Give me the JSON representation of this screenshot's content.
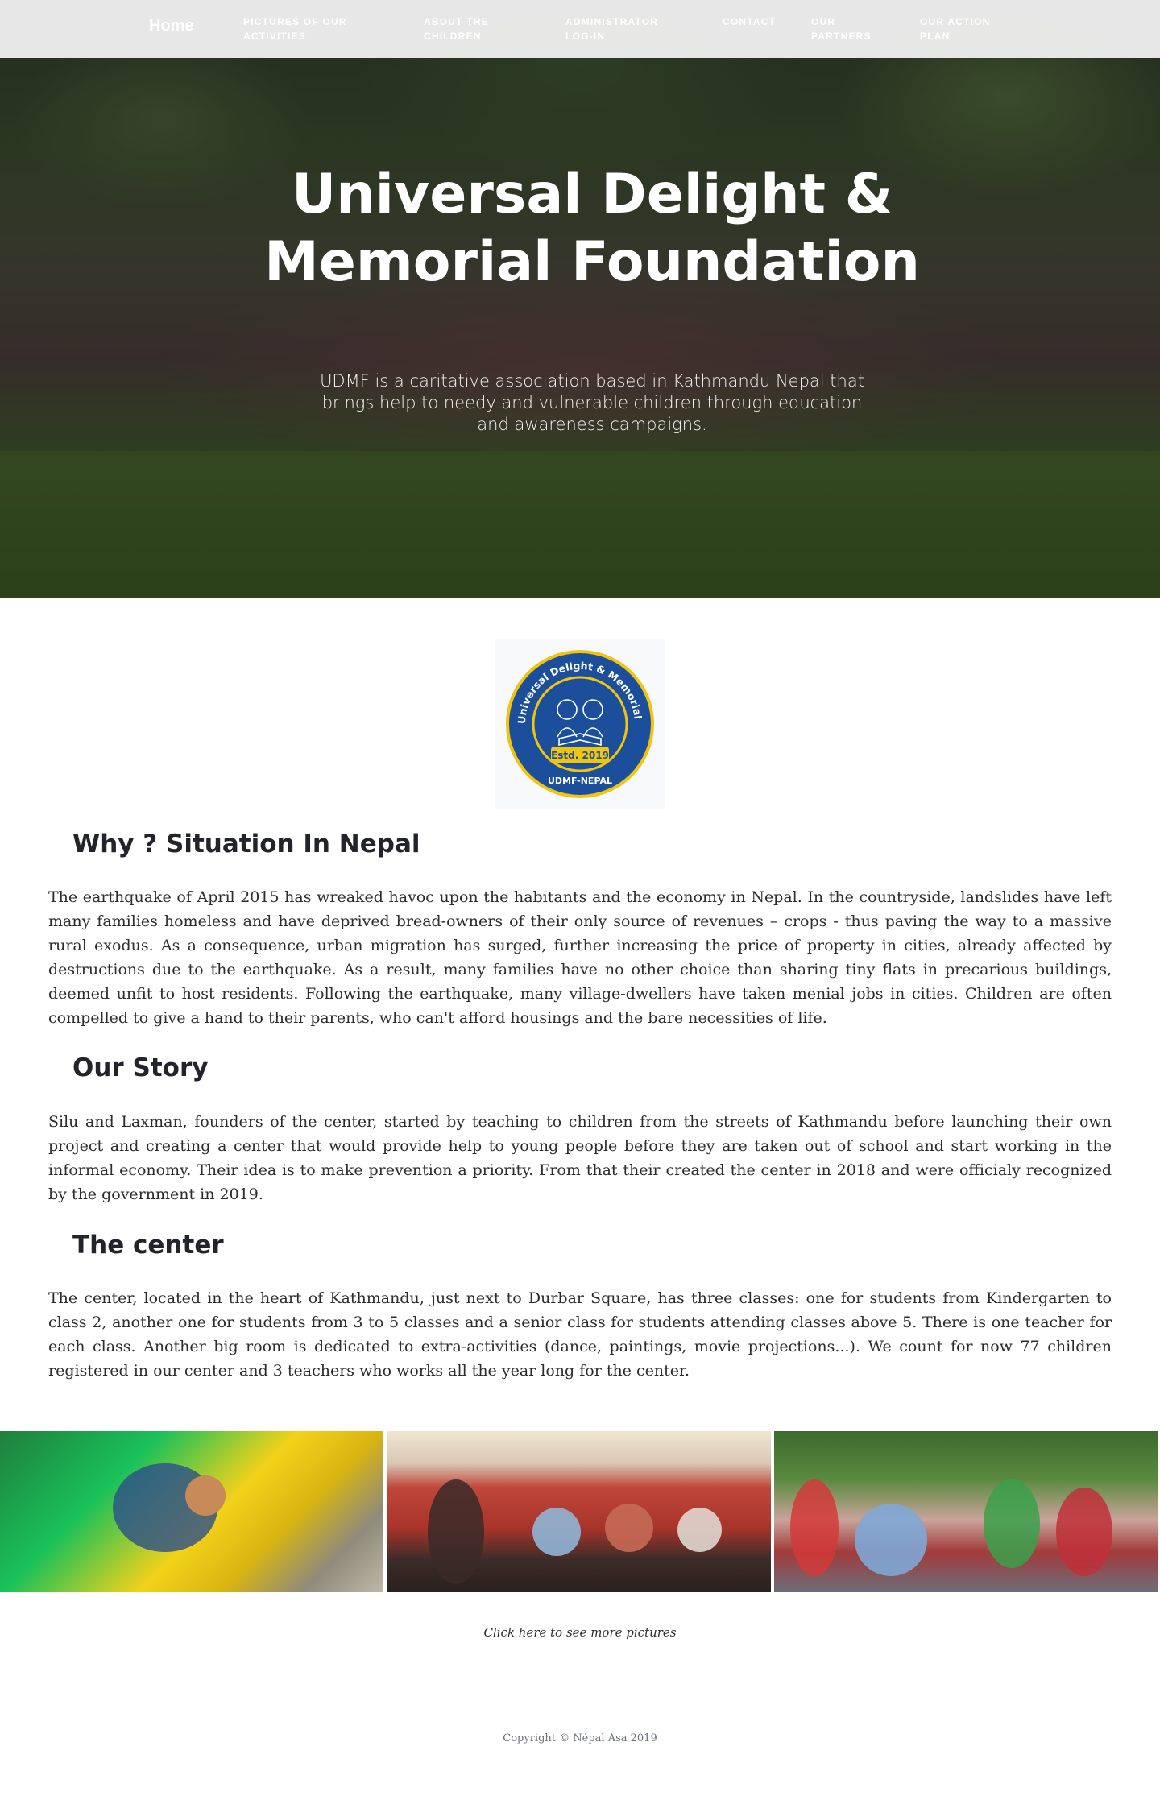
{
  "nav": {
    "home": "Home",
    "items": [
      "PICTURES OF OUR ACTIVITIES",
      "ABOUT THE CHILDREN",
      "ADMINISTRATOR LOG-IN",
      "CONTACT",
      "OUR PARTNERS",
      "OUR ACTION PLAN"
    ]
  },
  "hero": {
    "title": "Universal Delight & Memorial Foundation",
    "subtitle": "UDMF is a caritative association based in Kathmandu Nepal that brings help to needy and vulnerable children through education and awareness campaigns."
  },
  "logo": {
    "ring_text": "Universal Delight & Memorial Foundation Nepal",
    "established": "Estd. 2019",
    "bottom_text": "UDMF-NEPAL",
    "colors": {
      "ring": "#1b4f9c",
      "border": "#f1c40f",
      "inner": "#ffffff"
    }
  },
  "sections": [
    {
      "title": "Why ? Situation In Nepal",
      "body": "The earthquake of April 2015 has wreaked havoc upon the habitants and the economy in Nepal. In the countryside, landslides have left many families homeless and have deprived bread-owners of their only source of revenues – crops - thus paving the way to a massive rural exodus. As a consequence, urban migration has surged, further increasing the price of property in cities, already affected by destructions due to the earthquake. As a result, many families have no other choice than sharing tiny flats in precarious buildings, deemed unfit to host residents. Following the earthquake, many village-dwellers have taken menial jobs in cities. Children are often compelled to give a hand to their parents, who can't afford housings and the bare necessities of life."
    },
    {
      "title": "Our Story",
      "body": "Silu and Laxman, founders of the center, started by teaching to children from the streets of Kathmandu before launching their own project and creating a center that would provide help to young people before they are taken out of school and start working in the informal economy. Their idea is to make prevention a priority. From that their created the center in 2018 and were officialy recognized by the government in 2019."
    },
    {
      "title": "The center",
      "body": "The center, located in the heart of Kathmandu, just next to Durbar Square, has three classes: one for students from Kindergarten to class 2, another one for students from 3 to 5 classes and a senior class for students attending classes above 5. There is one teacher for each class. Another big room is dedicated to extra-activities (dance, paintings, movie projections...). We count for now 77 children registered in our center and 3 teachers who works all the year long for the center."
    }
  ],
  "gallery": {
    "more_link": "Click here to see more pictures"
  },
  "footer": {
    "copyright": "Copyright © Népal Asa 2019"
  }
}
